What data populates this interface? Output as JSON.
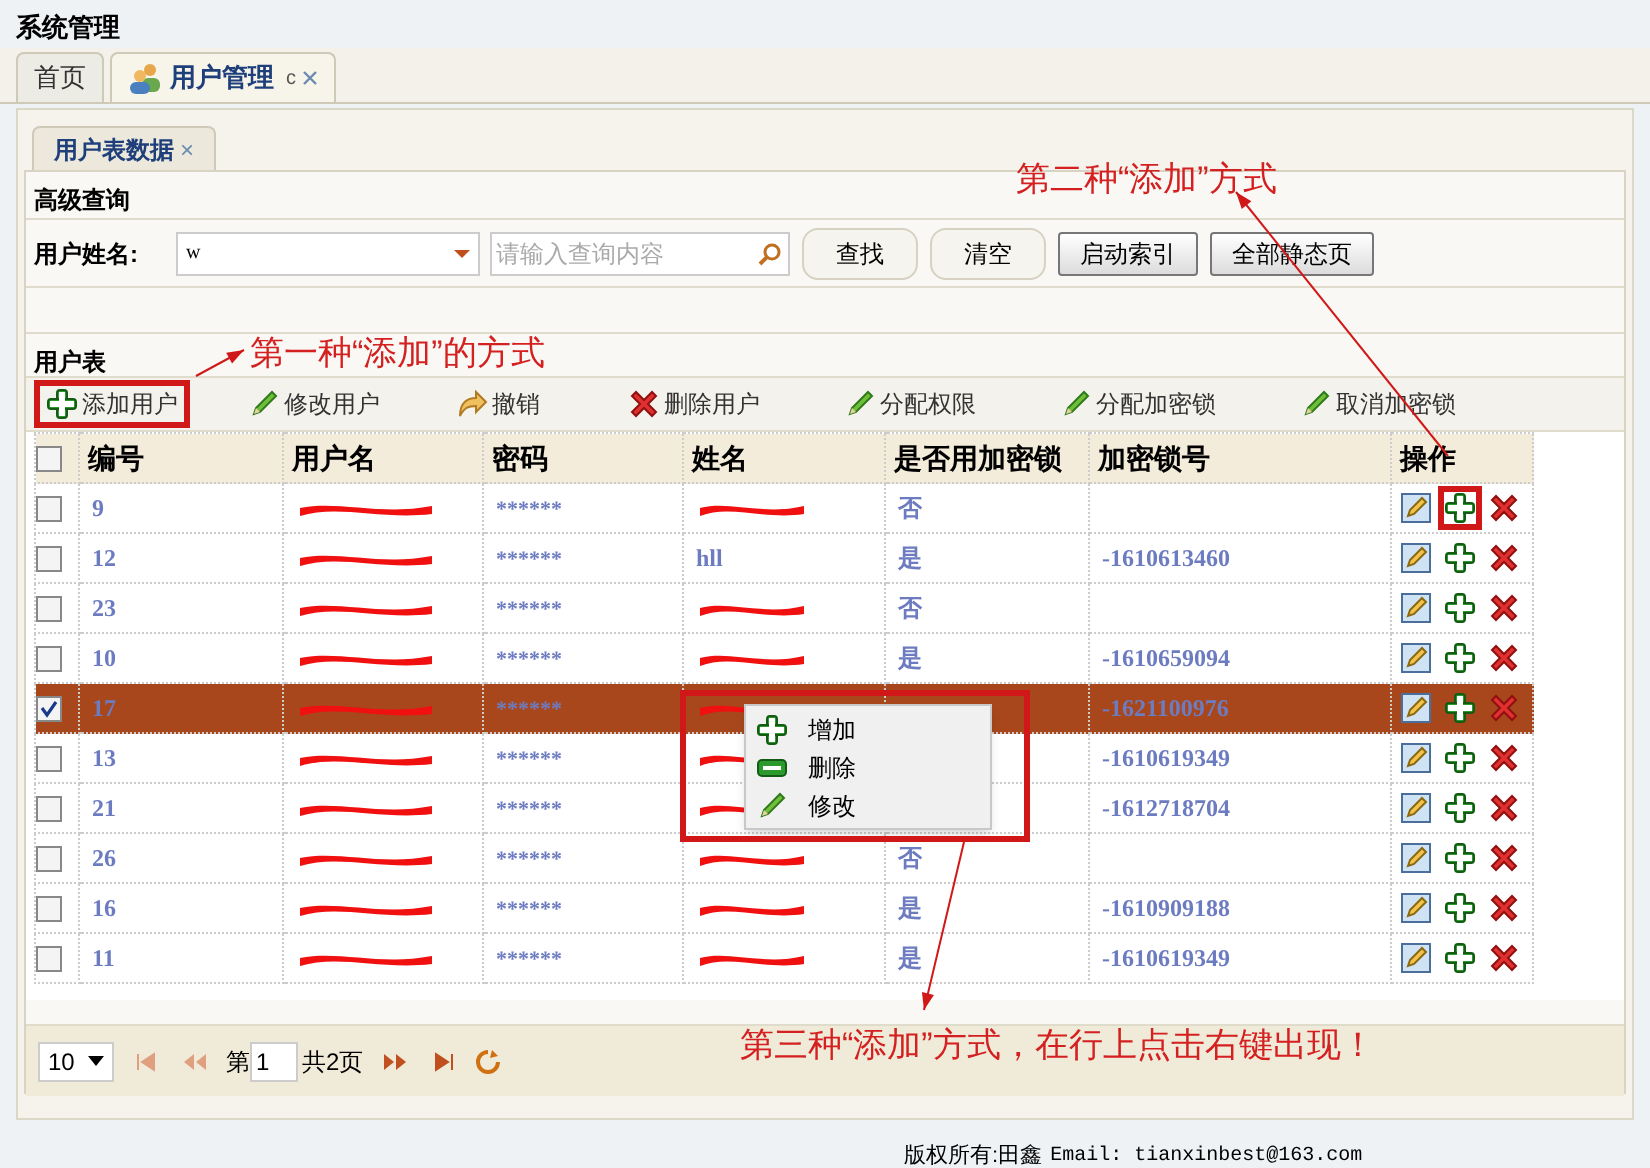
{
  "window": {
    "title": "系统管理"
  },
  "tabs": [
    {
      "label": "首页",
      "selected": false,
      "icon": false,
      "closable": false
    },
    {
      "label": "用户管理",
      "selected": true,
      "icon": true,
      "closable": true,
      "refresh": "c"
    }
  ],
  "inner_tab": {
    "label": "用户表数据",
    "close": "×"
  },
  "query": {
    "title": "高级查询",
    "field_label": "用户姓名:",
    "select_value": "w",
    "placeholder": "请输入查询内容",
    "buttons": [
      {
        "label": "查找",
        "kind": "round"
      },
      {
        "label": "清空",
        "kind": "round"
      },
      {
        "label": "启动索引",
        "kind": "square"
      },
      {
        "label": "全部静态页",
        "kind": "square"
      }
    ]
  },
  "grid": {
    "title": "用户表",
    "all_checked": false,
    "toolbar": [
      {
        "label": "添加用户",
        "kind": "add"
      },
      {
        "label": "修改用户",
        "kind": "edit"
      },
      {
        "label": "撤销",
        "kind": "undo"
      },
      {
        "label": "删除用户",
        "kind": "delete"
      },
      {
        "label": "分配权限",
        "kind": "edit"
      },
      {
        "label": "分配加密锁",
        "kind": "edit"
      },
      {
        "label": "取消加密锁",
        "kind": "edit"
      }
    ],
    "columns": [
      "编号",
      "用户名",
      "密码",
      "姓名",
      "是否用加密锁",
      "加密锁号",
      "操作"
    ],
    "rows": [
      {
        "id": "9",
        "username": "",
        "username_redacted": true,
        "password": "******",
        "name": "",
        "name_redacted": true,
        "uses_lock": "否",
        "lock_no": "",
        "selected": false
      },
      {
        "id": "12",
        "username": "",
        "username_redacted": true,
        "password": "******",
        "name": "hll",
        "name_redacted": false,
        "uses_lock": "是",
        "lock_no": "-1610613460",
        "selected": false
      },
      {
        "id": "23",
        "username": "",
        "username_redacted": true,
        "password": "******",
        "name": "",
        "name_redacted": true,
        "uses_lock": "否",
        "lock_no": "",
        "selected": false
      },
      {
        "id": "10",
        "username": "",
        "username_redacted": true,
        "password": "******",
        "name": "",
        "name_redacted": true,
        "uses_lock": "是",
        "lock_no": "-1610659094",
        "selected": false
      },
      {
        "id": "17",
        "username": "",
        "username_redacted": true,
        "password": "******",
        "name": "",
        "name_redacted": true,
        "uses_lock": "",
        "lock_no": "-1621100976",
        "selected": true
      },
      {
        "id": "13",
        "username": "",
        "username_redacted": true,
        "password": "******",
        "name": "",
        "name_redacted": true,
        "uses_lock": "",
        "lock_no": "-1610619349",
        "selected": false
      },
      {
        "id": "21",
        "username": "",
        "username_redacted": true,
        "password": "******",
        "name": "",
        "name_redacted": true,
        "uses_lock": "",
        "lock_no": "-1612718704",
        "selected": false
      },
      {
        "id": "26",
        "username": "",
        "username_redacted": true,
        "password": "******",
        "name": "",
        "name_redacted": true,
        "uses_lock": "否",
        "lock_no": "",
        "selected": false
      },
      {
        "id": "16",
        "username": "",
        "username_redacted": true,
        "password": "******",
        "name": "",
        "name_redacted": true,
        "uses_lock": "是",
        "lock_no": "-1610909188",
        "selected": false
      },
      {
        "id": "11",
        "username": "",
        "username_redacted": true,
        "password": "******",
        "name": "",
        "name_redacted": true,
        "uses_lock": "是",
        "lock_no": "-1610619349",
        "selected": false
      }
    ]
  },
  "context_menu": [
    {
      "label": "增加",
      "kind": "add"
    },
    {
      "label": "删除",
      "kind": "remove"
    },
    {
      "label": "修改",
      "kind": "edit"
    }
  ],
  "pager": {
    "page_size": "10",
    "page_prefix": "第",
    "page": "1",
    "total": "共2页"
  },
  "footer": {
    "copyright": "版权所有:田鑫",
    "email": "Email: tianxinbest@163.com"
  },
  "annotations": [
    {
      "text": "第一种“添加”的方式"
    },
    {
      "text": "第二种“添加”方式"
    },
    {
      "text": "第三种“添加”方式，在行上点击右键出现！"
    }
  ]
}
